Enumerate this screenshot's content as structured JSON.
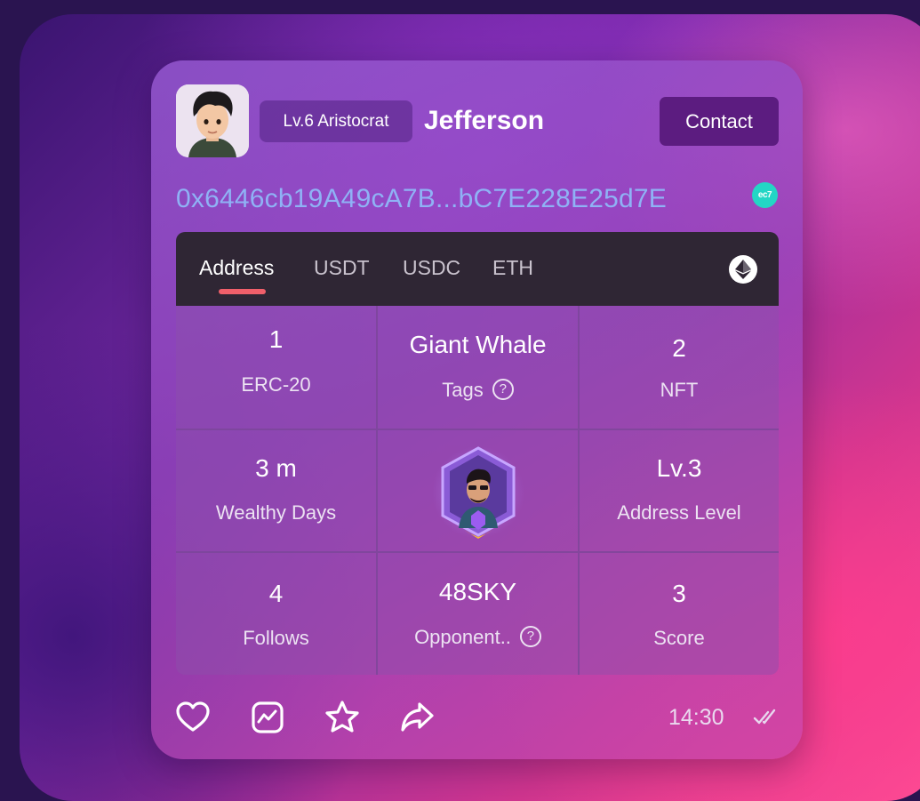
{
  "profile": {
    "level_badge": "Lv.6 Aristocrat",
    "username": "Jefferson",
    "contact_label": "Contact",
    "wallet_address": "0x6446cb19A49cA7B...bC7E228E25d7E",
    "chain_icon_text": "ec7"
  },
  "tabs": [
    {
      "label": "Address",
      "active": true
    },
    {
      "label": "USDT",
      "active": false
    },
    {
      "label": "USDC",
      "active": false
    },
    {
      "label": "ETH",
      "active": false
    }
  ],
  "stats": {
    "erc20": {
      "value": "1",
      "label": "ERC-20"
    },
    "tags": {
      "value": "Giant Whale",
      "label": "Tags"
    },
    "nft": {
      "value": "2",
      "label": "NFT"
    },
    "wealthy_days": {
      "value": "3 m",
      "label": "Wealthy Days"
    },
    "address_level": {
      "value": "Lv.3",
      "label": "Address Level"
    },
    "follows": {
      "value": "4",
      "label": "Follows"
    },
    "opponent": {
      "value": "48SKY",
      "label": "Opponent.."
    },
    "score": {
      "value": "3",
      "label": "Score"
    }
  },
  "footer": {
    "time": "14:30",
    "icons": [
      "heart-icon",
      "chart-icon",
      "star-icon",
      "share-icon",
      "double-check-icon"
    ]
  },
  "colors": {
    "accent_underline": "#f05f6a",
    "address_text": "#8fb2f5",
    "contact_button": "#5c1c80",
    "chain_badge": "#23d6c5"
  }
}
